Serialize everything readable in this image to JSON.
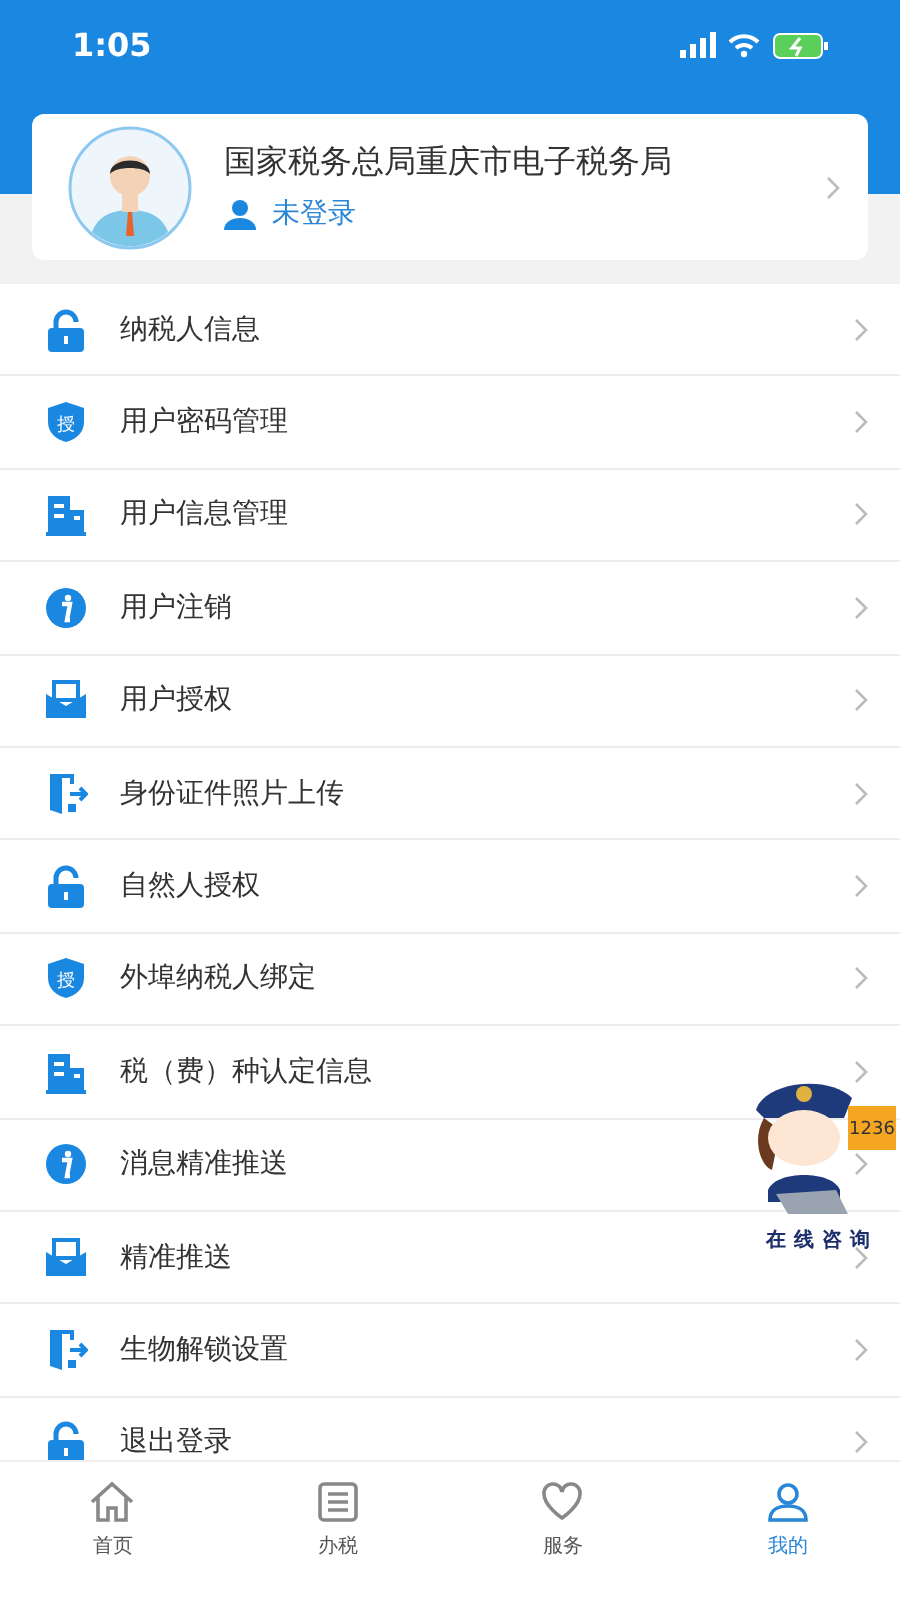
{
  "status_bar": {
    "time": "1:05"
  },
  "profile": {
    "title": "国家税务总局重庆市电子税务局",
    "login_status": "未登录"
  },
  "menu": [
    {
      "kind": "lock",
      "label": "纳税人信息"
    },
    {
      "kind": "shield",
      "label": "用户密码管理",
      "icon_text": "授"
    },
    {
      "kind": "building",
      "label": "用户信息管理"
    },
    {
      "kind": "info",
      "label": "用户注销"
    },
    {
      "kind": "mail",
      "label": "用户授权"
    },
    {
      "kind": "door",
      "label": "身份证件照片上传"
    },
    {
      "kind": "lock",
      "label": "自然人授权"
    },
    {
      "kind": "shield",
      "label": "外埠纳税人绑定",
      "icon_text": "授"
    },
    {
      "kind": "building",
      "label": "税（费）种认定信息"
    },
    {
      "kind": "info",
      "label": "消息精准推送"
    },
    {
      "kind": "mail",
      "label": "精准推送"
    },
    {
      "kind": "door",
      "label": "生物解锁设置"
    },
    {
      "kind": "lock",
      "label": "退出登录"
    }
  ],
  "assistant": {
    "label": "在线咨询",
    "screen_text": "1236"
  },
  "tabs": [
    {
      "kind": "home",
      "label": "首页",
      "selected": false
    },
    {
      "kind": "list",
      "label": "办税",
      "selected": false
    },
    {
      "kind": "heart",
      "label": "服务",
      "selected": false
    },
    {
      "kind": "person",
      "label": "我的",
      "selected": true
    }
  ]
}
